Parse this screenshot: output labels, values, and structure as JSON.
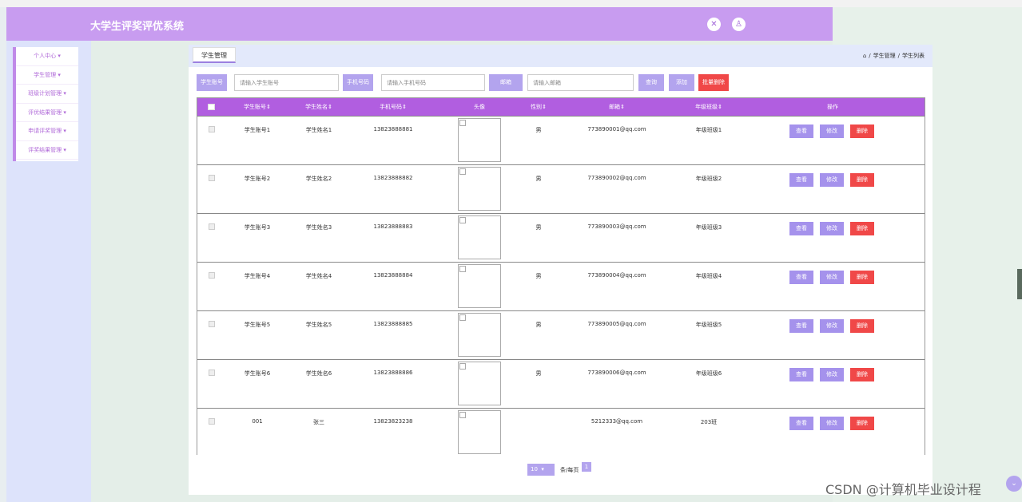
{
  "app": {
    "title": "大学生评奖评优系统"
  },
  "colors": {
    "header": "#c89cf0",
    "accent": "#b15ee0",
    "button": "#a592ec",
    "danger": "#f04848"
  },
  "header": {
    "icons": [
      "fullscreen-icon",
      "user-icon"
    ]
  },
  "sidebar": {
    "items": [
      "个人中心",
      "学生管理",
      "班级计划管理",
      "评优结果管理",
      "申请评奖管理",
      "评奖结果管理"
    ]
  },
  "tab": {
    "label": "学生管理"
  },
  "breadcrumb": {
    "items": [
      "学生管理",
      "学生列表"
    ]
  },
  "search": {
    "account_label": "学生账号",
    "account_placeholder": "请输入学生账号",
    "phone_label": "手机号码",
    "phone_placeholder": "请输入手机号码",
    "email_label": "邮箱",
    "email_placeholder": "请输入邮箱",
    "query_label": "查询",
    "add_label": "添加",
    "batch_delete_label": "批量删除"
  },
  "table": {
    "headers": [
      "学生账号",
      "学生姓名",
      "手机号码",
      "头像",
      "性别",
      "邮箱",
      "年级班级",
      "操作"
    ],
    "action_labels": {
      "view": "查看",
      "edit": "修改",
      "delete": "删除"
    },
    "rows": [
      {
        "account": "学生账号1",
        "name": "学生姓名1",
        "phone": "13823888881",
        "gender": "男",
        "email": "773890001@qq.com",
        "class": "年级班级1"
      },
      {
        "account": "学生账号2",
        "name": "学生姓名2",
        "phone": "13823888882",
        "gender": "男",
        "email": "773890002@qq.com",
        "class": "年级班级2"
      },
      {
        "account": "学生账号3",
        "name": "学生姓名3",
        "phone": "13823888883",
        "gender": "男",
        "email": "773890003@qq.com",
        "class": "年级班级3"
      },
      {
        "account": "学生账号4",
        "name": "学生姓名4",
        "phone": "13823888884",
        "gender": "男",
        "email": "773890004@qq.com",
        "class": "年级班级4"
      },
      {
        "account": "学生账号5",
        "name": "学生姓名5",
        "phone": "13823888885",
        "gender": "男",
        "email": "773890005@qq.com",
        "class": "年级班级5"
      },
      {
        "account": "学生账号6",
        "name": "学生姓名6",
        "phone": "13823888886",
        "gender": "男",
        "email": "773890006@qq.com",
        "class": "年级班级6"
      },
      {
        "account": "001",
        "name": "张三",
        "phone": "13823823238",
        "gender": "",
        "email": "5212333@qq.com",
        "class": "203班"
      }
    ]
  },
  "pager": {
    "page_size": "10",
    "per_page_label": "条/每页",
    "current_page": "1"
  },
  "watermark": "CSDN @计算机毕业设计程"
}
